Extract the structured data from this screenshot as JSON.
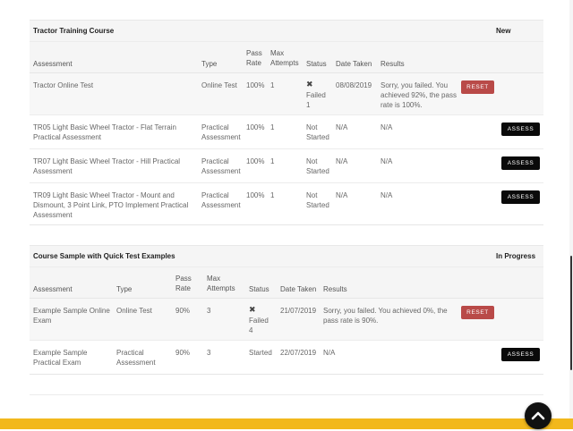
{
  "courses": [
    {
      "title": "Tractor Training Course",
      "status": "New",
      "columns": {
        "assessment": "Assessment",
        "type": "Type",
        "pass_rate": "Pass Rate",
        "max_attempts": "Max Attempts",
        "status": "Status",
        "date_taken": "Date Taken",
        "results": "Results"
      },
      "rows": [
        {
          "assessment": "Tractor Online Test",
          "type": "Online Test",
          "pass_rate": "100%",
          "max_attempts": "1",
          "status_icon": "✖",
          "status": "Failed 1",
          "date_taken": "08/08/2019",
          "results": "Sorry, you failed. You achieved 92%, the pass rate is 100%.",
          "action": "RESET"
        },
        {
          "assessment": "TR05 Light Basic Wheel Tractor - Flat Terrain Practical Assessment",
          "type": "Practical Assessment",
          "pass_rate": "100%",
          "max_attempts": "1",
          "status": "Not Started",
          "date_taken": "N/A",
          "results": "N/A",
          "action": "ASSESS"
        },
        {
          "assessment": "TR07 Light Basic Wheel Tractor - Hill Practical Assessment",
          "type": "Practical Assessment",
          "pass_rate": "100%",
          "max_attempts": "1",
          "status": "Not Started",
          "date_taken": "N/A",
          "results": "N/A",
          "action": "ASSESS"
        },
        {
          "assessment": "TR09 Light Basic Wheel Tractor - Mount and Dismount, 3 Point Link, PTO Implement Practical Assessment",
          "type": "Practical Assessment",
          "pass_rate": "100%",
          "max_attempts": "1",
          "status": "Not Started",
          "date_taken": "N/A",
          "results": "N/A",
          "action": "ASSESS"
        }
      ]
    },
    {
      "title": "Course Sample with Quick Test Examples",
      "status": "In Progress",
      "columns": {
        "assessment": "Assessment",
        "type": "Type",
        "pass_rate": "Pass Rate",
        "max_attempts": "Max Attempts",
        "status": "Status",
        "date_taken": "Date Taken",
        "results": "Results"
      },
      "rows": [
        {
          "assessment": "Example Sample Online Exam",
          "type": "Online Test",
          "pass_rate": "90%",
          "max_attempts": "3",
          "status_icon": "✖",
          "status": "Failed 4",
          "date_taken": "21/07/2019",
          "results": "Sorry, you failed. You achieved 0%, the pass rate is 90%.",
          "action": "RESET"
        },
        {
          "assessment": "Example Sample Practical Exam",
          "type": "Practical Assessment",
          "pass_rate": "90%",
          "max_attempts": "3",
          "status": "Started",
          "date_taken": "22/07/2019",
          "results": "N/A",
          "action": "ASSESS"
        }
      ]
    }
  ],
  "scroll_top_icon": "chevron-up-icon",
  "colors": {
    "reset": "#b94a48",
    "assess": "#0a0a0a",
    "footer": "#f2b81c"
  }
}
